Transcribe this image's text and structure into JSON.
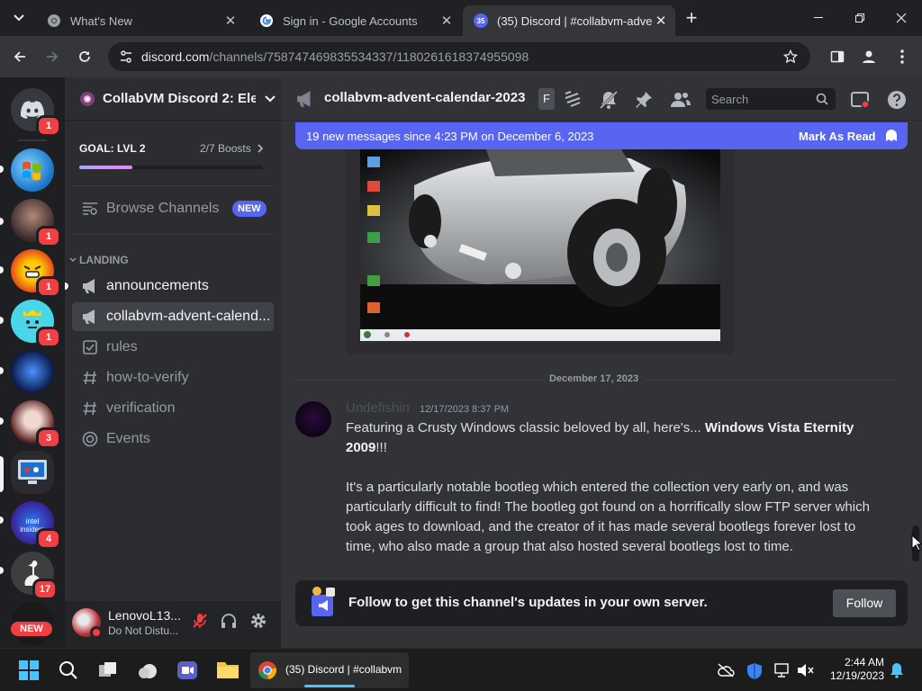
{
  "browser": {
    "tabs": [
      {
        "title": "What's New",
        "close": "✕"
      },
      {
        "title": "Sign in - Google Accounts",
        "close": "✕"
      },
      {
        "title": "(35) Discord | #collabvm-adven",
        "close": "✕",
        "favicon_count": "35"
      }
    ],
    "new_tab": "+",
    "url_host": "discord.com",
    "url_path": "/channels/758747469835534337/1180261618374955098"
  },
  "discord": {
    "guild_name": "CollabVM Discord 2: Ele",
    "boost_goal": "GOAL: LVL 2",
    "boost_count": "2/7 Boosts",
    "boost_progress": 0.29,
    "browse_channels": "Browse Channels",
    "new_badge": "NEW",
    "category": "LANDING",
    "channels": [
      {
        "name": "announcements",
        "icon": "announcement-icon",
        "state": "unread"
      },
      {
        "name": "collabvm-advent-calend...",
        "icon": "announcement-icon",
        "state": "selected"
      },
      {
        "name": "rules",
        "icon": "rules-icon",
        "state": "read"
      },
      {
        "name": "how-to-verify",
        "icon": "hash-icon",
        "state": "read"
      },
      {
        "name": "verification",
        "icon": "hash-icon",
        "state": "read"
      },
      {
        "name": "Events",
        "icon": "events-icon",
        "state": "read"
      }
    ],
    "guild_badges": [
      "1",
      "1",
      "1",
      "1",
      "3",
      "4",
      "17"
    ],
    "new_pill": "NEW",
    "user": {
      "name": "LenovoL13...",
      "status": "Do Not Distu..."
    },
    "header": {
      "channel": "collabvm-advent-calendar-2023",
      "follow_short": "F",
      "search_placeholder": "Search"
    },
    "new_messages_bar": {
      "text": "19 new messages since 4:23 PM on December 6, 2023",
      "action": "Mark As Read"
    },
    "date_divider": "December 17, 2023",
    "message": {
      "author": "Undefishin",
      "timestamp": "12/17/2023 8:37 PM",
      "line1_pre": "Featuring a Crusty Windows classic beloved by all, here's...",
      "line1_bold": "Windows Vista Eternity 2009",
      "line1_post": "!!!",
      "para2": "It's a particularly notable bootleg which entered the collection very early on, and was particularly difficult to find! The bootleg got found on a horrifically slow FTP server which took ages to download, and the creator of it has made several bootlegs forever lost to time, who also made a group that also hosted several bootlegs lost to time."
    },
    "follow_bar": {
      "text": "Follow to get this channel's updates in your own server.",
      "button": "Follow"
    }
  },
  "taskbar": {
    "active_app": "(35) Discord | #collabvm",
    "time": "2:44 AM",
    "date": "12/19/2023"
  },
  "colors": {
    "blurple": "#5865f2",
    "red": "#f23f43",
    "bg_chat": "#313338",
    "bg_sidebar": "#2b2d31",
    "bg_guilds": "#1e1f22"
  }
}
